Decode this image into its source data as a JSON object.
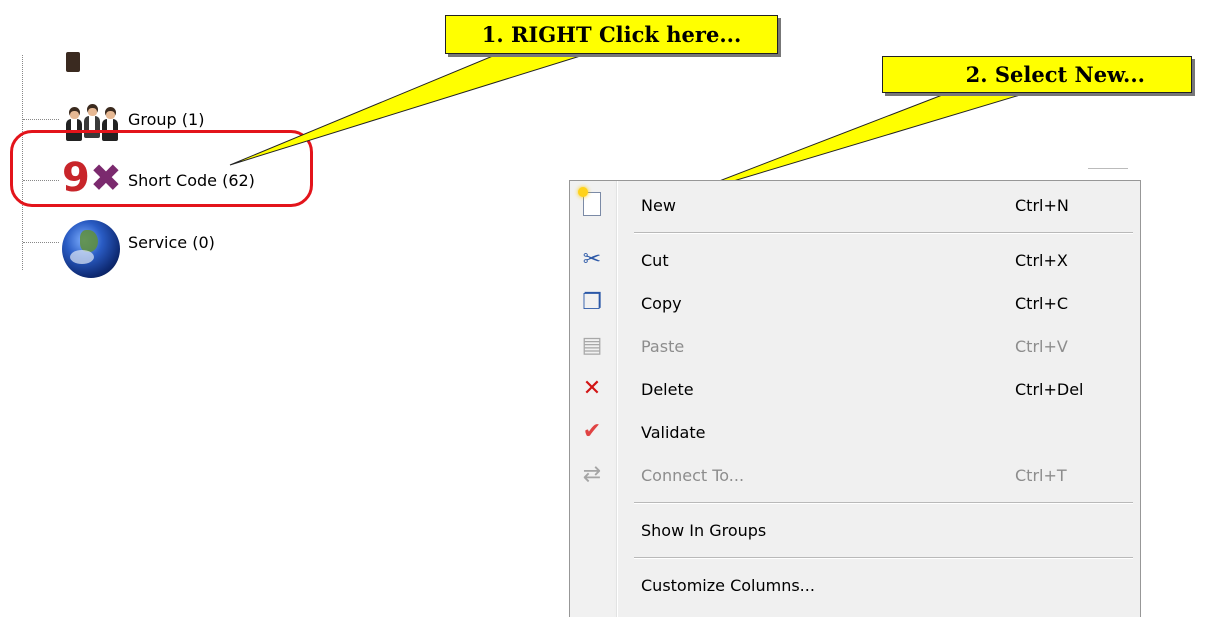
{
  "callouts": {
    "step1": "1. RIGHT Click here...",
    "step2": "2. Select New..."
  },
  "tree": {
    "items": [
      {
        "label": "Group (1)",
        "icon": "group-icon"
      },
      {
        "label": "Short Code (62)",
        "icon": "short-code-9x-icon"
      },
      {
        "label": "Service (0)",
        "icon": "globe-icon"
      }
    ]
  },
  "menu": {
    "items": [
      {
        "label": "New",
        "shortcut": "Ctrl+N",
        "icon": "new-document-icon",
        "enabled": true
      },
      {
        "label": "Cut",
        "shortcut": "Ctrl+X",
        "icon": "scissors-icon",
        "enabled": true
      },
      {
        "label": "Copy",
        "shortcut": "Ctrl+C",
        "icon": "copy-icon",
        "enabled": true
      },
      {
        "label": "Paste",
        "shortcut": "Ctrl+V",
        "icon": "paste-icon",
        "enabled": false
      },
      {
        "label": "Delete",
        "shortcut": "Ctrl+Del",
        "icon": "delete-x-icon",
        "enabled": true
      },
      {
        "label": "Validate",
        "shortcut": "",
        "icon": "checkmark-icon",
        "enabled": true
      },
      {
        "label": "Connect To...",
        "shortcut": "Ctrl+T",
        "icon": "connect-arrows-icon",
        "enabled": false
      },
      {
        "label": "Show In Groups",
        "shortcut": "",
        "icon": "",
        "enabled": true
      },
      {
        "label": "Customize Columns...",
        "shortcut": "",
        "icon": "",
        "enabled": true
      }
    ]
  },
  "colors": {
    "callout_fill": "#ffff00",
    "highlight_ring": "#e3141b",
    "delete_icon": "#d21414",
    "disabled_text": "#8d8d8d"
  }
}
